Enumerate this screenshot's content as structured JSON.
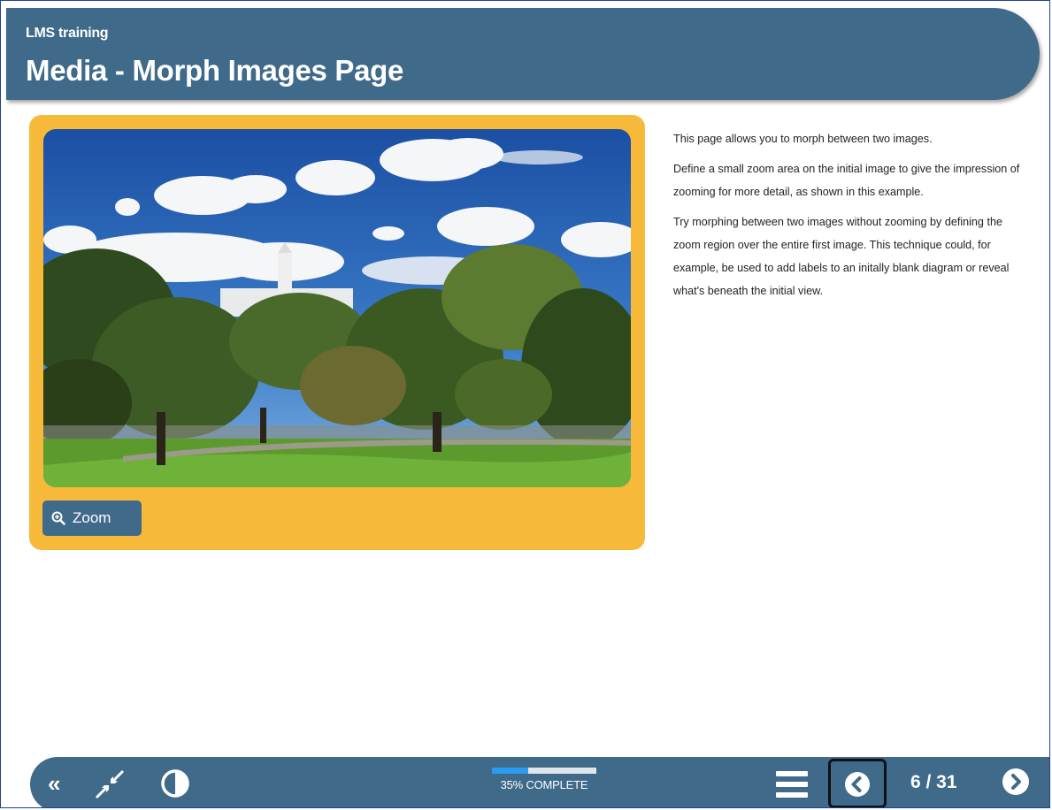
{
  "header": {
    "course_title": "LMS training",
    "page_title": "Media - Morph Images Page",
    "color": "#3f6a8a"
  },
  "media": {
    "card_color": "#f6b93a",
    "image_icon": "landscape-photo",
    "zoom_button": {
      "label": "Zoom",
      "icon": "magnifier-icon"
    }
  },
  "content": {
    "paragraphs": [
      "This page allows you to morph between two images.",
      "Define a small zoom area on the initial image to give the impression of zooming for more detail, as shown in this example.",
      "Try morphing between two images without zooming by defining the zoom region over the entire first image. This technique could, for example, be used to add labels to an initally blank diagram or reveal what's beneath the initial view."
    ]
  },
  "footer": {
    "icons": [
      "double-chevron-left-icon",
      "exit-fullscreen-icon",
      "contrast-icon",
      "menu-icon",
      "chevron-left-circle-icon",
      "chevron-right-circle-icon"
    ],
    "progress": {
      "percent": 35,
      "label": "35% COMPLETE",
      "fill_color": "#2a9bf0"
    },
    "page_indicator": "6 / 31"
  }
}
